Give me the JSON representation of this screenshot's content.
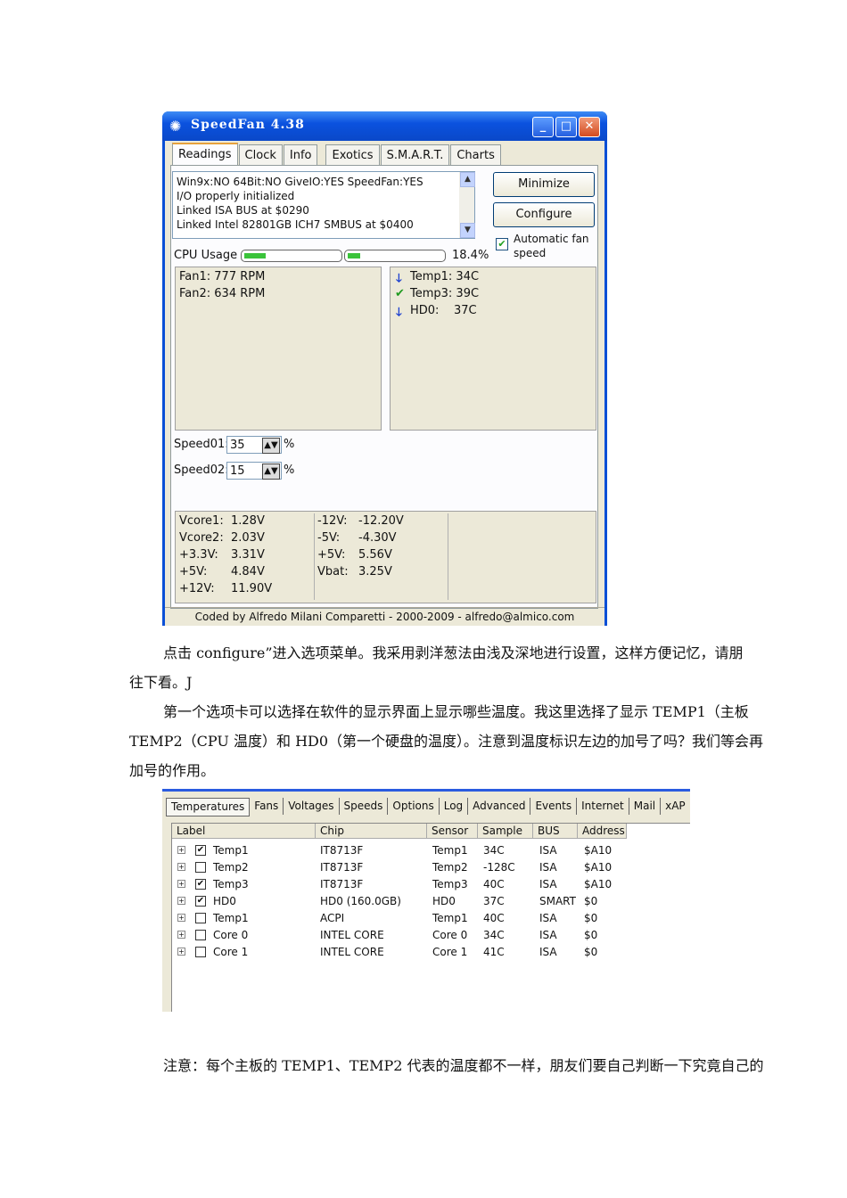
{
  "window": {
    "title": "SpeedFan 4.38",
    "tabs": [
      "Readings",
      "Clock",
      "Info",
      "Exotics",
      "S.M.A.R.T.",
      "Charts"
    ],
    "log_lines": [
      "Win9x:NO  64Bit:NO  GiveIO:YES  SpeedFan:YES",
      "I/O properly initialized",
      "Linked ISA BUS at $0290",
      "Linked Intel 82801GB ICH7 SMBUS at $0400"
    ],
    "minimize_label": "Minimize",
    "configure_label": "Configure",
    "auto_fan_label_1": "Automatic fan",
    "auto_fan_label_2": "speed",
    "cpu_usage_label": "CPU Usage",
    "cpu_usage_value": "18.4%",
    "cpu_usage_fraction": 0.184,
    "fans": [
      "Fan1: 777 RPM",
      "Fan2: 634 RPM"
    ],
    "temps": [
      {
        "icon": "down-arrow-icon",
        "glyph": "🡓",
        "text": "Temp1: 34C"
      },
      {
        "icon": "checkmark-icon",
        "glyph": "✔",
        "text": "Temp3: 39C"
      },
      {
        "icon": "down-arrow-icon",
        "glyph": "🡓",
        "text": "HD0:    37C"
      }
    ],
    "speed01_label": "Speed01:",
    "speed01_value": "35",
    "speed02_label": "Speed02:",
    "speed02_value": "15",
    "percent": "%",
    "voltages_left": [
      [
        "Vcore1:",
        "1.28V"
      ],
      [
        "Vcore2:",
        "2.03V"
      ],
      [
        "+3.3V:",
        "3.31V"
      ],
      [
        "+5V:",
        "4.84V"
      ],
      [
        "+12V:",
        "11.90V"
      ]
    ],
    "voltages_right": [
      [
        "-12V:",
        "-12.20V"
      ],
      [
        "-5V:",
        "-4.30V"
      ],
      [
        "+5V:",
        "5.56V"
      ],
      [
        "Vbat:",
        "3.25V"
      ]
    ],
    "status": "Coded by Alfredo Milani Comparetti - 2000-2009 - alfredo@almico.com"
  },
  "text": {
    "p1_line1": "点击  configure”进入选项菜单。我采用剥洋葱法由浅及深地进行设置，这样方便记忆，请朋",
    "p1_line2": "往下看。J",
    "p2_line1": "第一个选项卡可以选择在软件的显示界面上显示哪些温度。我这里选择了显示 TEMP1（主板",
    "p2_line2": "TEMP2（CPU 温度）和 HD0（第一个硬盘的温度）。注意到温度标识左边的加号了吗？我们等会再",
    "p2_line3": "加号的作用。",
    "p3_line1": "注意：每个主板的 TEMP1、TEMP2   代表的温度都不一样，朋友们要自己判断一下究竟自己的"
  },
  "config": {
    "tabs": [
      "Temperatures",
      "Fans",
      "Voltages",
      "Speeds",
      "Options",
      "Log",
      "Advanced",
      "Events",
      "Internet",
      "Mail",
      "xAP"
    ],
    "headers": [
      "Label",
      "Chip",
      "Sensor",
      "Sample",
      "BUS",
      "Address"
    ],
    "rows": [
      {
        "checked": true,
        "label": "Temp1",
        "chip": "IT8713F",
        "sensor": "Temp1",
        "sample": "34C",
        "bus": "ISA",
        "address": "$A10"
      },
      {
        "checked": false,
        "label": "Temp2",
        "chip": "IT8713F",
        "sensor": "Temp2",
        "sample": "-128C",
        "bus": "ISA",
        "address": "$A10"
      },
      {
        "checked": true,
        "label": "Temp3",
        "chip": "IT8713F",
        "sensor": "Temp3",
        "sample": "40C",
        "bus": "ISA",
        "address": "$A10"
      },
      {
        "checked": true,
        "label": "HD0",
        "chip": "HD0 (160.0GB)",
        "sensor": "HD0",
        "sample": "37C",
        "bus": "SMART",
        "address": "$0"
      },
      {
        "checked": false,
        "label": "Temp1",
        "chip": "ACPI",
        "sensor": "Temp1",
        "sample": "40C",
        "bus": "ISA",
        "address": "$0"
      },
      {
        "checked": false,
        "label": "Core 0",
        "chip": "INTEL CORE",
        "sensor": "Core 0",
        "sample": "34C",
        "bus": "ISA",
        "address": "$0"
      },
      {
        "checked": false,
        "label": "Core 1",
        "chip": "INTEL CORE",
        "sensor": "Core 1",
        "sample": "41C",
        "bus": "ISA",
        "address": "$0"
      }
    ]
  }
}
